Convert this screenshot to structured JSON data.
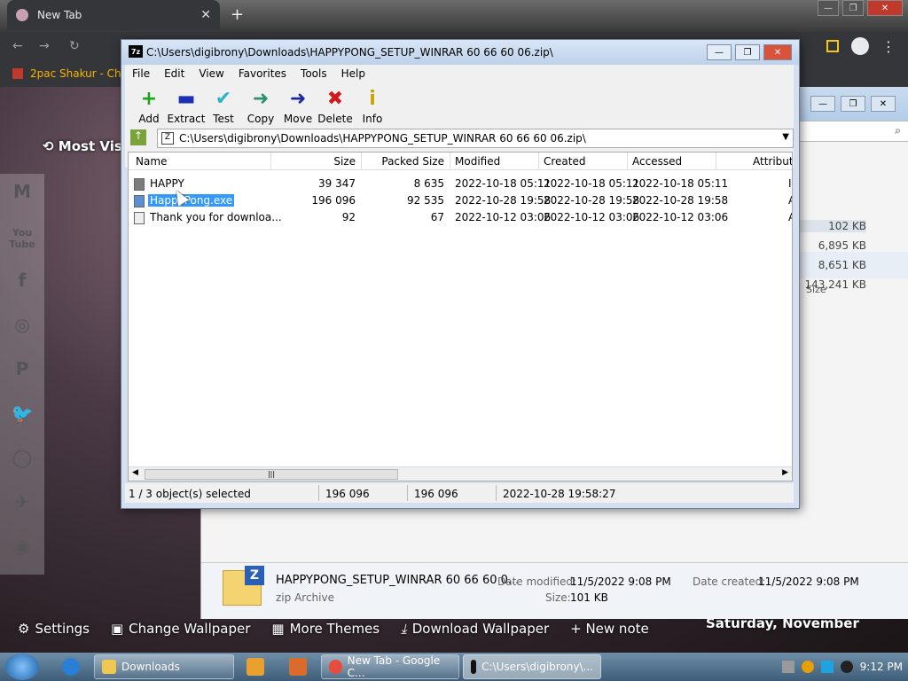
{
  "chrome": {
    "tab_title": "New Tab",
    "bookmark": "2pac Shakur - Chro",
    "most_visited": "Most Visi"
  },
  "newtab": {
    "social": [
      "M",
      "You Tube",
      "f",
      "◎",
      "P",
      "🐦",
      "◯",
      "✈",
      "◉"
    ],
    "bottom_links": [
      "Settings",
      "Change Wallpaper",
      "More Themes",
      "Download Wallpaper",
      "+ New note"
    ],
    "date": "Saturday, November"
  },
  "explorer": {
    "size_header": "Size",
    "sizes": [
      "102 KB",
      "6,895 KB",
      "8,651 KB",
      "143,241 KB"
    ],
    "details": {
      "name": "HAPPYPONG_SETUP_WINRAR 60 66 60 0...",
      "type": "zip Archive",
      "modified_label": "Date modified:",
      "modified_value": "11/5/2022 9:08 PM",
      "size_label": "Size:",
      "size_value": "101 KB",
      "created_label": "Date created:",
      "created_value": "11/5/2022 9:08 PM"
    }
  },
  "sevenzip": {
    "title": "C:\\Users\\digibrony\\Downloads\\HAPPYPONG_SETUP_WINRAR 60 66 60 06.zip\\",
    "menu": [
      "File",
      "Edit",
      "View",
      "Favorites",
      "Tools",
      "Help"
    ],
    "tools": [
      {
        "label": "Add",
        "icon": "+",
        "color": "#1aa51a"
      },
      {
        "label": "Extract",
        "icon": "▬",
        "color": "#1c2fb5"
      },
      {
        "label": "Test",
        "icon": "✔",
        "color": "#2bb3c7"
      },
      {
        "label": "Copy",
        "icon": "➜",
        "color": "#2a8f6e"
      },
      {
        "label": "Move",
        "icon": "➜",
        "color": "#1a2a9e"
      },
      {
        "label": "Delete",
        "icon": "✖",
        "color": "#d11a1a"
      },
      {
        "label": "Info",
        "icon": "i",
        "color": "#c9a400"
      }
    ],
    "address": "C:\\Users\\digibrony\\Downloads\\HAPPYPONG_SETUP_WINRAR 60 66 60 06.zip\\",
    "columns": [
      "Name",
      "Size",
      "Packed Size",
      "Modified",
      "Created",
      "Accessed",
      "Attribute"
    ],
    "rows": [
      {
        "name": "HAPPY",
        "size": "39 347",
        "packed": "8 635",
        "modified": "2022-10-18 05:11",
        "created": "2022-10-18 05:11",
        "accessed": "2022-10-18 05:11",
        "attr": "I"
      },
      {
        "name": "HappyPong.exe",
        "size": "196 096",
        "packed": "92 535",
        "modified": "2022-10-28 19:58",
        "created": "2022-10-28 19:58",
        "accessed": "2022-10-28 19:58",
        "attr": "A"
      },
      {
        "name": "Thank you for downloa...",
        "size": "92",
        "packed": "67",
        "modified": "2022-10-12 03:06",
        "created": "2022-10-12 03:06",
        "accessed": "2022-10-12 03:06",
        "attr": "A"
      }
    ],
    "status": {
      "selected": "1 / 3 object(s) selected",
      "size": "196 096",
      "packed": "196 096",
      "date": "2022-10-28 19:58:27"
    }
  },
  "taskbar": {
    "buttons": [
      "Downloads",
      "New Tab - Google C...",
      "C:\\Users\\digibrony\\..."
    ],
    "time": "9:12 PM"
  }
}
